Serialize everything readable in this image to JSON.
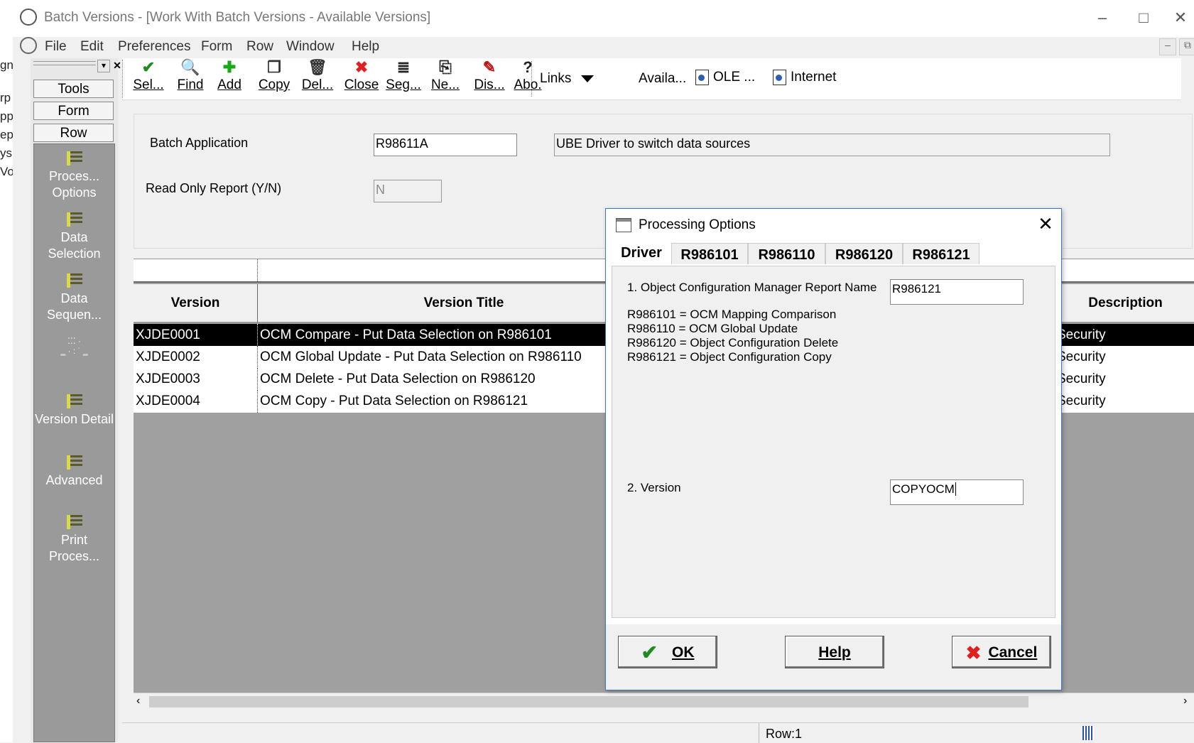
{
  "background_window": {
    "text_fragments": [
      "gn",
      "rp",
      "pp",
      "ep",
      "ys",
      "Vo"
    ]
  },
  "window": {
    "title": "Batch Versions - [Work With Batch Versions - Available Versions]",
    "controls": [
      "–",
      "□",
      "✕"
    ]
  },
  "menu": {
    "items": [
      "File",
      "Edit",
      "Preferences",
      "Form",
      "Row",
      "Window",
      "Help"
    ]
  },
  "tools_panel": {
    "tabs": [
      "Tools",
      "Form",
      "Row"
    ],
    "items": [
      "Proces... Options",
      "Data Selection",
      "Data Sequen...",
      "Version Detail",
      "Advanced",
      "Print Proces..."
    ]
  },
  "toolbar": {
    "buttons": [
      {
        "label": "Sel...",
        "icon": "checkmark-icon",
        "glyph": "✔",
        "color": "#1f8a1f"
      },
      {
        "label": "Find",
        "icon": "find-icon",
        "glyph": "🔍",
        "color": "#333333"
      },
      {
        "label": "Add",
        "icon": "add-icon",
        "glyph": "✚",
        "color": "#18a818"
      },
      {
        "label": "Copy",
        "icon": "copy-icon",
        "glyph": "❐",
        "color": "#333333"
      },
      {
        "label": "Del...",
        "icon": "trash-icon",
        "glyph": "🗑",
        "color": "#333333"
      },
      {
        "label": "Close",
        "icon": "close-x-icon",
        "glyph": "✖",
        "color": "#e02020"
      },
      {
        "label": "Seg...",
        "icon": "segment-icon",
        "glyph": "≣",
        "color": "#222222"
      },
      {
        "label": "Ne...",
        "icon": "new-icon",
        "glyph": "⎘",
        "color": "#222222"
      },
      {
        "label": "Dis...",
        "icon": "display-icon",
        "glyph": "✎",
        "color": "#c01010"
      },
      {
        "label": "Abo.",
        "icon": "about-icon",
        "glyph": "?",
        "color": "#222222"
      }
    ],
    "links_label": "Links",
    "available_label": "Availa...",
    "ole_label": "OLE ...",
    "internet_label": "Internet"
  },
  "header_form": {
    "batch_application_label": "Batch Application",
    "batch_application_value": "R98611A",
    "batch_application_description": "UBE Driver to switch data sources",
    "read_only_label": "Read Only Report (Y/N)",
    "read_only_value": "N"
  },
  "grid": {
    "columns": [
      "Version",
      "Version Title",
      "Description"
    ],
    "rows": [
      {
        "version": "XJDE0001",
        "title": "OCM Compare - Put Data Selection on R986101",
        "description": "Security",
        "selected": true
      },
      {
        "version": "XJDE0002",
        "title": "OCM Global Update - Put Data Selection on R986110",
        "description": "Security",
        "selected": false
      },
      {
        "version": "XJDE0003",
        "title": "OCM Delete - Put Data Selection on R986120",
        "description": "Security",
        "selected": false
      },
      {
        "version": "XJDE0004",
        "title": "OCM Copy - Put Data Selection on R986121",
        "description": "Security",
        "selected": false
      }
    ]
  },
  "status": {
    "row": "Row:1"
  },
  "dialog": {
    "title": "Processing Options",
    "tabs": [
      "Driver",
      "R986101",
      "R986110",
      "R986120",
      "R986121"
    ],
    "active_tab": "Driver",
    "option1_label": "1. Object Configuration Manager Report Name",
    "option1_value": "R986121",
    "option1_help": [
      "R986101 = OCM Mapping Comparison",
      "R986110 = OCM Global Update",
      "R986120 = Object Configuration Delete",
      "R986121 = Object Configuration Copy"
    ],
    "option2_label": "2.  Version",
    "option2_value": "COPYOCM",
    "buttons": {
      "ok": "OK",
      "help": "Help",
      "cancel": "Cancel"
    }
  },
  "colors": {
    "accent_border": "#3b78c4",
    "selected_row_bg": "#000000",
    "grid_empty_bg": "#a0a0a0",
    "tools_list_bg": "#9a9a9a"
  }
}
